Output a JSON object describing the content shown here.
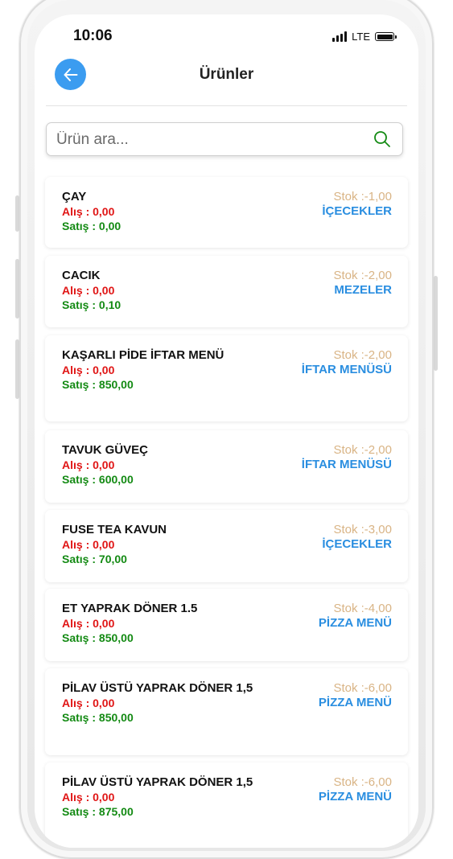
{
  "status_bar": {
    "time": "10:06",
    "network": "LTE"
  },
  "header": {
    "title": "Ürünler"
  },
  "search": {
    "placeholder": "Ürün ara..."
  },
  "products": [
    {
      "name": "ÇAY",
      "alis": "Alış : 0,00",
      "satis": "Satış : 0,00",
      "stok": "Stok :-1,00",
      "category": "İÇECEKLER"
    },
    {
      "name": "CACIK",
      "alis": "Alış : 0,00",
      "satis": "Satış : 0,10",
      "stok": "Stok :-2,00",
      "category": "MEZELER"
    },
    {
      "name": "KAŞARLI PİDE İFTAR MENÜ",
      "alis": "Alış : 0,00",
      "satis": "Satış : 850,00",
      "stok": "Stok :-2,00",
      "category": "İFTAR MENÜSÜ"
    },
    {
      "name": "TAVUK GÜVEÇ",
      "alis": "Alış : 0,00",
      "satis": "Satış : 600,00",
      "stok": "Stok :-2,00",
      "category": "İFTAR MENÜSÜ"
    },
    {
      "name": "FUSE TEA KAVUN",
      "alis": "Alış : 0,00",
      "satis": "Satış : 70,00",
      "stok": "Stok :-3,00",
      "category": "İÇECEKLER"
    },
    {
      "name": "ET YAPRAK DÖNER 1.5",
      "alis": "Alış : 0,00",
      "satis": "Satış : 850,00",
      "stok": "Stok :-4,00",
      "category": "PİZZA MENÜ"
    },
    {
      "name": "PİLAV ÜSTÜ YAPRAK DÖNER 1,5",
      "alis": "Alış : 0,00",
      "satis": "Satış : 850,00",
      "stok": "Stok :-6,00",
      "category": "PİZZA MENÜ"
    },
    {
      "name": "PİLAV ÜSTÜ YAPRAK DÖNER 1,5",
      "alis": "Alış : 0,00",
      "satis": "Satış : 875,00",
      "stok": "Stok :-6,00",
      "category": "PİZZA MENÜ"
    }
  ],
  "colors": {
    "accent": "#3b9cf0",
    "alis": "#e01515",
    "satis": "#138a13",
    "stok": "#d9b485",
    "category": "#2a8ee0"
  }
}
